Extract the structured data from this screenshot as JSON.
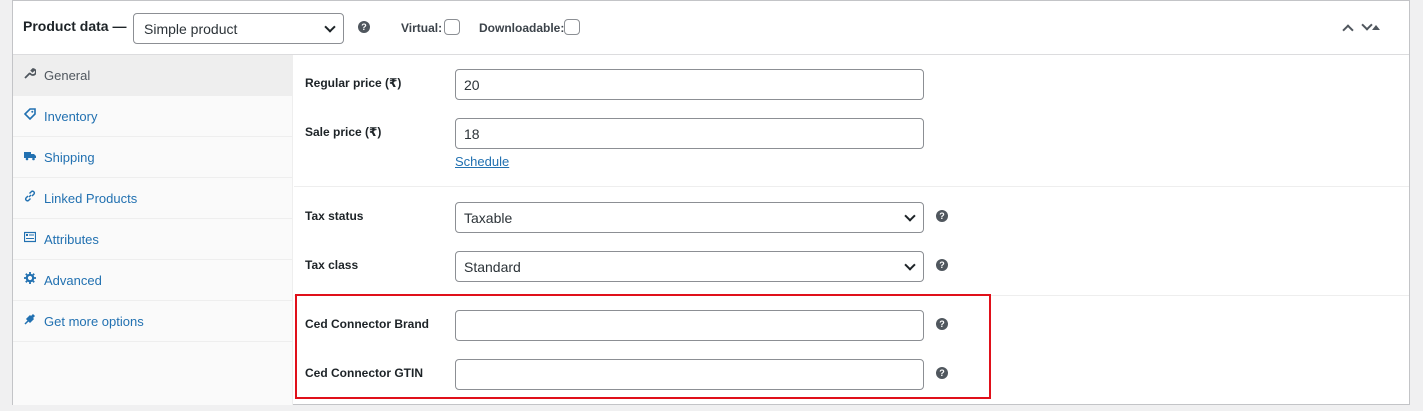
{
  "header": {
    "title": "Product data —",
    "product_type": "Simple product",
    "virtual_label": "Virtual:",
    "downloadable_label": "Downloadable:"
  },
  "sidebar": {
    "items": [
      {
        "label": "General",
        "icon": "wrench-icon",
        "active": true
      },
      {
        "label": "Inventory",
        "icon": "tag-icon"
      },
      {
        "label": "Shipping",
        "icon": "truck-icon"
      },
      {
        "label": "Linked Products",
        "icon": "link-icon"
      },
      {
        "label": "Attributes",
        "icon": "list-card-icon"
      },
      {
        "label": "Advanced",
        "icon": "gear-icon"
      },
      {
        "label": "Get more options",
        "icon": "plugin-icon"
      }
    ]
  },
  "fields": {
    "regular_price": {
      "label": "Regular price (₹)",
      "value": "20"
    },
    "sale_price": {
      "label": "Sale price (₹)",
      "value": "18"
    },
    "schedule_link": "Schedule",
    "tax_status": {
      "label": "Tax status",
      "value": "Taxable"
    },
    "tax_class": {
      "label": "Tax class",
      "value": "Standard"
    },
    "ced_brand": {
      "label": "Ced Connector Brand",
      "value": ""
    },
    "ced_gtin": {
      "label": "Ced Connector GTIN",
      "value": ""
    }
  },
  "colors": {
    "accent_link": "#2271b1",
    "highlight_border": "#e0101a",
    "sidebar_bg": "#fafafa",
    "active_tab_bg": "#eeeeee"
  }
}
